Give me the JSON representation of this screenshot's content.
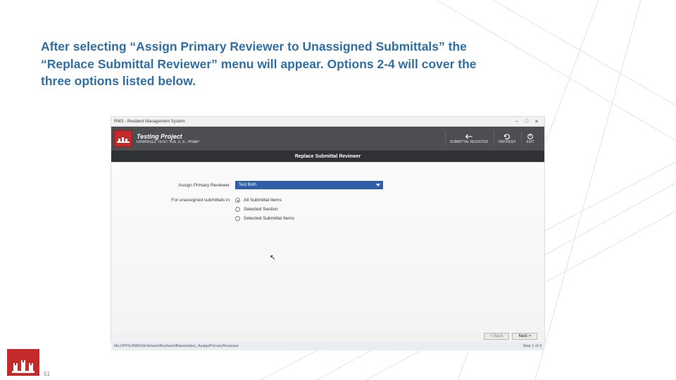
{
  "heading": "After selecting “Assign Primary Reviewer to Unassigned Submittals” the “Replace Submittal Reviewer” menu will appear. Options 2-4 will cover the three options listed below.",
  "app": {
    "window_title": "RMS - Resident Management System",
    "win_min": "–",
    "win_max": "□",
    "win_close": "✕",
    "project_title": "Testing Project",
    "project_sub": "DA905112 TEST RJL 2, E, RS&P",
    "actions": {
      "back": "SUBMITTAL REGISTER",
      "refresh": "REFRESH",
      "exit": "EXIT"
    },
    "page_title": "Replace Submittal Reviewer",
    "field_label": "Assign Primary Reviewer",
    "field_value": "Test Both",
    "group_label": "For unassigned submittals in",
    "options": [
      "All Submittal Items",
      "Selected Section",
      "Selected Submittal Items"
    ],
    "selected_option": 0,
    "back_btn": "< Back",
    "next_btn": "Next >",
    "path": "file:///PFILRMS/htmls/workflow/workflowwindow_AssignPrimaryReviewer",
    "right_footer": "Step 1 of 3"
  },
  "page_number": "51"
}
